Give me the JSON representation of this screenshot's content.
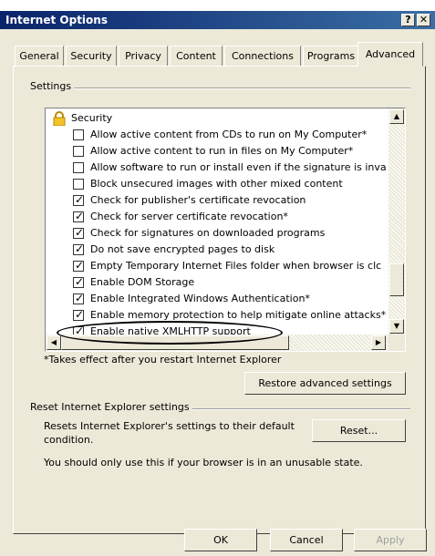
{
  "window": {
    "title": "Internet Options"
  },
  "titlebar_buttons": {
    "help": "?",
    "close": "✕"
  },
  "tabs": [
    {
      "label": "General"
    },
    {
      "label": "Security"
    },
    {
      "label": "Privacy"
    },
    {
      "label": "Content"
    },
    {
      "label": "Connections"
    },
    {
      "label": "Programs"
    },
    {
      "label": "Advanced",
      "active": true
    }
  ],
  "settings": {
    "group_label": "Settings",
    "category": {
      "label": "Security",
      "icon": "lock-icon"
    },
    "items": [
      {
        "label": "Allow active content from CDs to run on My Computer*",
        "checked": false
      },
      {
        "label": "Allow active content to run in files on My Computer*",
        "checked": false
      },
      {
        "label": "Allow software to run or install even if the signature is inva",
        "checked": false
      },
      {
        "label": "Block unsecured images with other mixed content",
        "checked": false
      },
      {
        "label": "Check for publisher's certificate revocation",
        "checked": true
      },
      {
        "label": "Check for server certificate revocation*",
        "checked": true
      },
      {
        "label": "Check for signatures on downloaded programs",
        "checked": true
      },
      {
        "label": "Do not save encrypted pages to disk",
        "checked": true
      },
      {
        "label": "Empty Temporary Internet Files folder when browser is clc",
        "checked": true
      },
      {
        "label": "Enable DOM Storage",
        "checked": true
      },
      {
        "label": "Enable Integrated Windows Authentication*",
        "checked": true
      },
      {
        "label": "Enable memory protection to help mitigate online attacks*",
        "checked": true
      },
      {
        "label": "Enable native XMLHTTP support",
        "checked": true,
        "highlighted": true
      }
    ],
    "footnote": "*Takes effect after you restart Internet Explorer",
    "restore_button": "Restore advanced settings"
  },
  "reset": {
    "group_label": "Reset Internet Explorer settings",
    "description": "Resets Internet Explorer's settings to their default condition.",
    "button": "Reset...",
    "warning": "You should only use this if your browser is in an unusable state."
  },
  "footer": {
    "ok": "OK",
    "cancel": "Cancel",
    "apply": "Apply"
  },
  "check_mark": "✓"
}
